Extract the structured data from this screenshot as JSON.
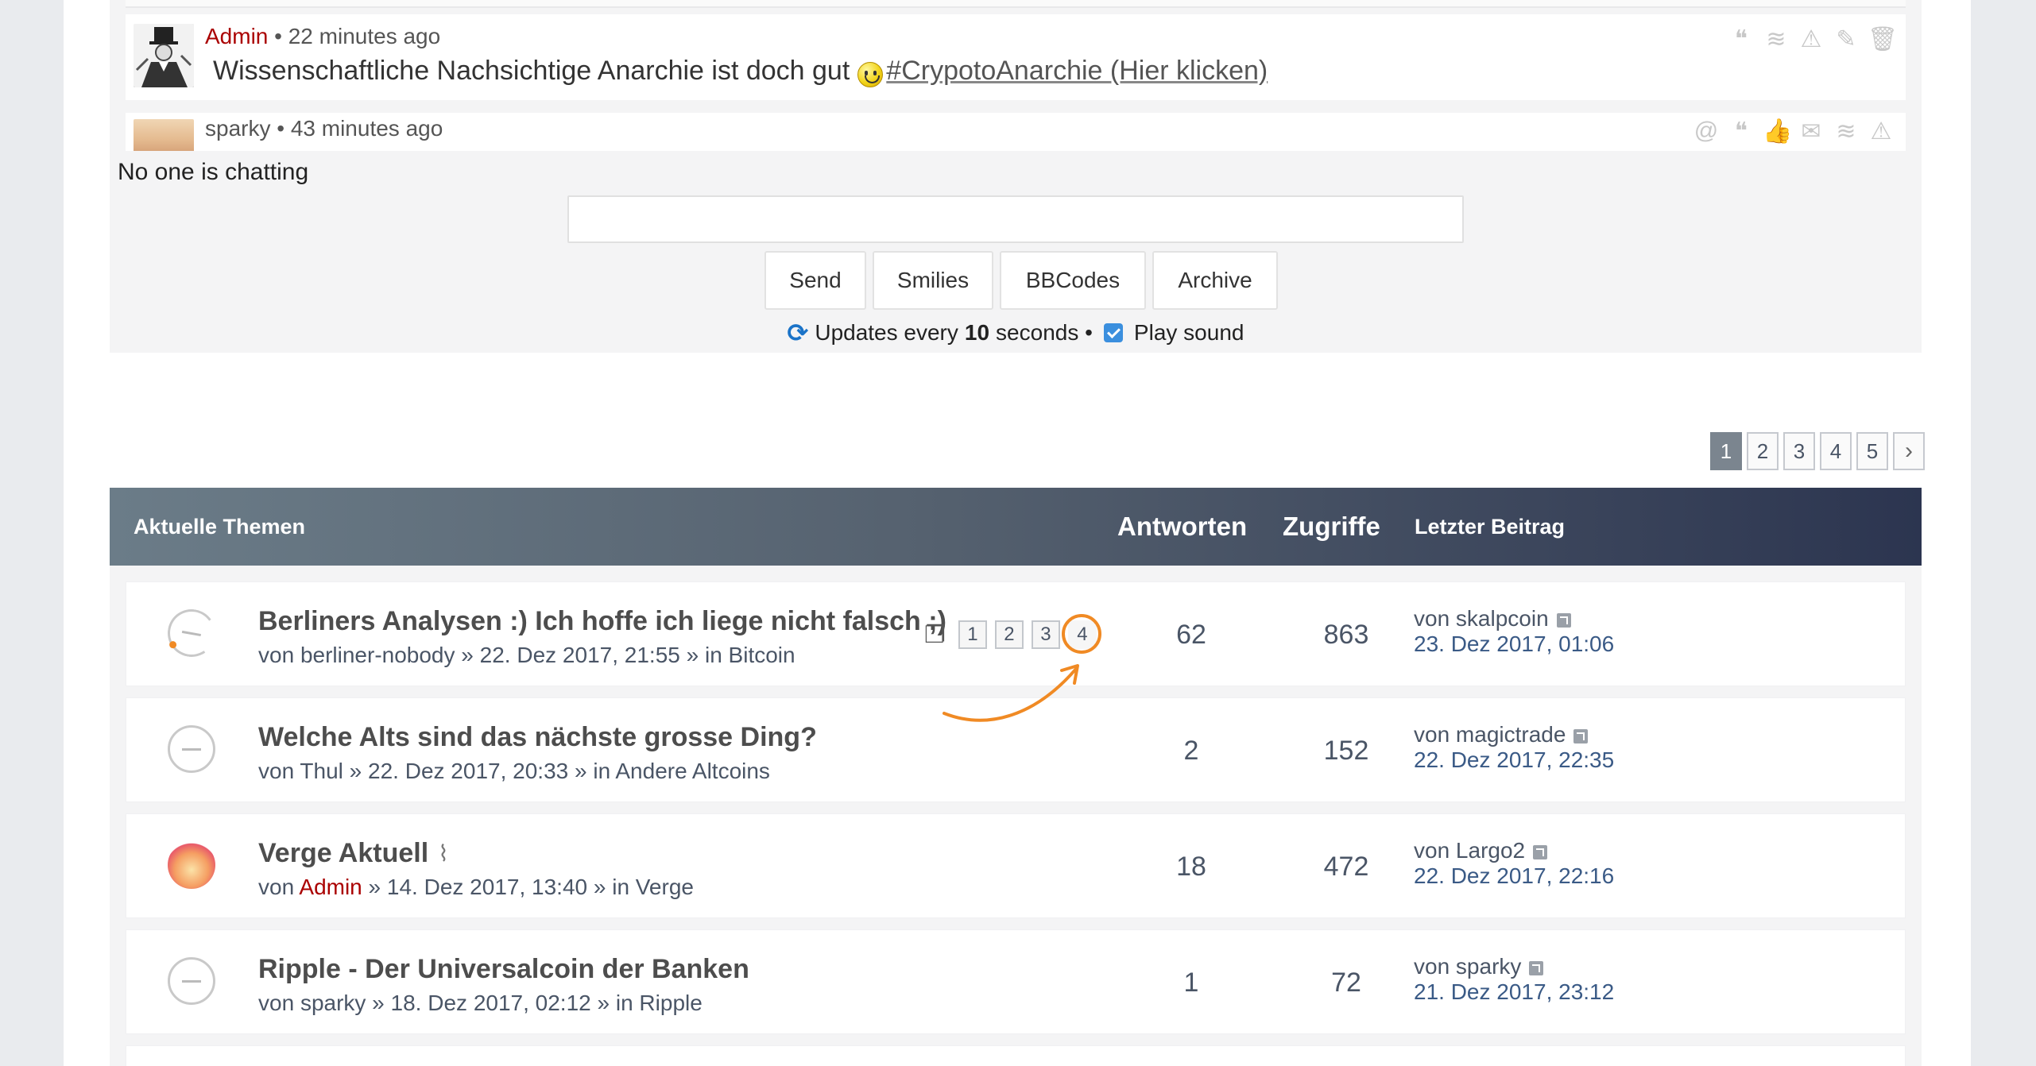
{
  "chat": {
    "messages": [
      {
        "author": "Admin",
        "time": " • 22 minutes ago",
        "text": "Wissenschaftliche Nachsichtige Anarchie ist doch gut",
        "link": "#CrypotoAnarchie (Hier klicken)"
      },
      {
        "author": "sparky",
        "time": " • 43 minutes ago"
      }
    ],
    "no_chat": "No one is chatting",
    "input_placeholder": "",
    "buttons": {
      "send": "Send",
      "smilies": "Smilies",
      "bbcodes": "BBCodes",
      "archive": "Archive"
    },
    "status_prefix": "Updates every ",
    "status_interval": "10",
    "status_suffix": " seconds •",
    "play_sound": "Play sound"
  },
  "pagination": {
    "pages": [
      "1",
      "2",
      "3",
      "4",
      "5"
    ],
    "next": "›"
  },
  "topics_header": {
    "title": "Aktuelle Themen",
    "antworten": "Antworten",
    "zugriffe": "Zugriffe",
    "letzter": "Letzter Beitrag"
  },
  "topics": [
    {
      "title": "Berliners Analysen :) Ich hoffe ich liege nicht falsch ;)",
      "meta_prefix": "von ",
      "author": "berliner-nobody",
      "meta_suffix": " » 22. Dez 2017, 21:55 » in Bitcoin",
      "pages": [
        "1",
        "2",
        "3",
        "4"
      ],
      "replies": "62",
      "views": "863",
      "last_by": "von skalpcoin",
      "last_date": "23. Dez 2017, 01:06"
    },
    {
      "title": "Welche Alts sind das nächste grosse Ding?",
      "meta_prefix": "von ",
      "author": "Thul",
      "meta_suffix": " » 22. Dez 2017, 20:33 » in Andere Altcoins",
      "replies": "2",
      "views": "152",
      "last_by": "von magictrade",
      "last_date": "22. Dez 2017, 22:35"
    },
    {
      "title": "Verge Aktuell",
      "meta_prefix": "von ",
      "author": "Admin",
      "meta_suffix": " » 14. Dez 2017, 13:40 » in Verge",
      "replies": "18",
      "views": "472",
      "last_by": "von Largo2",
      "last_date": "22. Dez 2017, 22:16"
    },
    {
      "title": "Ripple - Der Universalcoin der Banken",
      "meta_prefix": "von ",
      "author": "sparky",
      "meta_suffix": " » 18. Dez 2017, 02:12 » in Ripple",
      "replies": "1",
      "views": "72",
      "last_by": "von sparky",
      "last_date": "21. Dez 2017, 23:12"
    }
  ],
  "colors": {
    "accent": "#f08a24",
    "admin": "#aa0000",
    "header_start": "#6b7c88",
    "header_end": "#2c3550"
  }
}
